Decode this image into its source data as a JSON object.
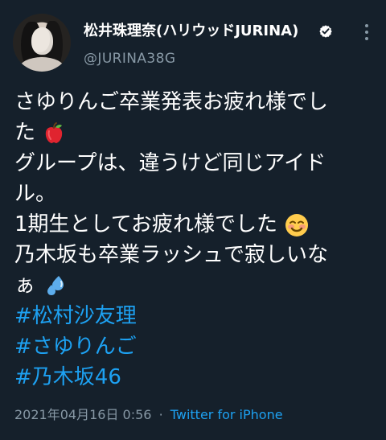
{
  "tweet": {
    "display_name": "松井珠理奈(ハリウッドJURINA)",
    "handle": "@JURINA38G",
    "lines": [
      "さゆりんご卒業発表お疲れ様でし",
      "た",
      "グループは、違うけど同じアイド",
      "ル。",
      "1期生としてお疲れ様でした",
      "乃木坂も卒業ラッシュで寂しいな",
      "ぁ"
    ],
    "hashtags": [
      "#松村沙友理",
      "#さゆりんご",
      "#乃木坂46"
    ],
    "timestamp": "2021年04月16日 0:56",
    "separator": "·",
    "source": "Twitter for iPhone"
  },
  "icons": {
    "verified": "verified-badge-icon",
    "more": "more-options-icon",
    "apple": "apple-emoji-icon",
    "smile": "smiling-face-emoji-icon",
    "droplets": "sweat-droplets-emoji-icon"
  },
  "colors": {
    "background": "#15202b",
    "text": "#ffffff",
    "secondary_text": "#8899a6",
    "link": "#1da1f2"
  }
}
